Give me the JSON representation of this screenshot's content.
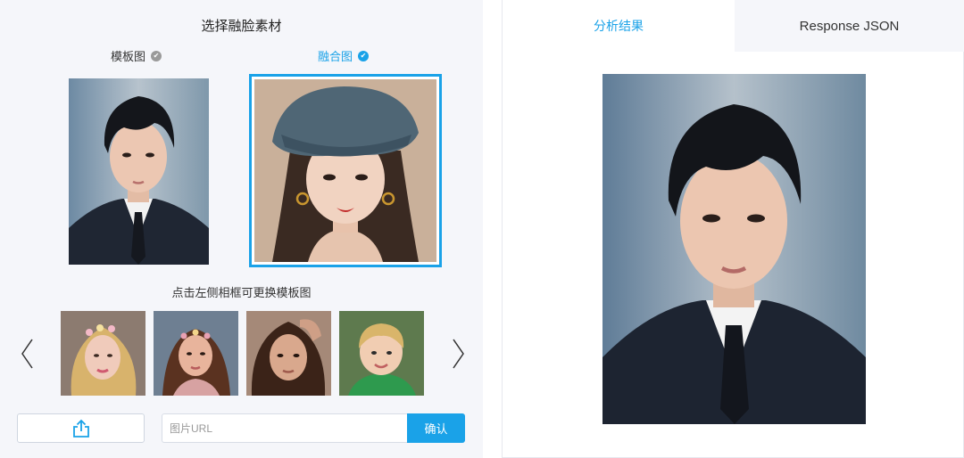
{
  "left": {
    "title": "选择融脸素材",
    "template_label": "模板图",
    "fusion_label": "融合图",
    "hint": "点击左侧相框可更换模板图",
    "url_placeholder": "图片URL",
    "confirm_label": "确认"
  },
  "tabs": [
    {
      "label": "分析结果",
      "active": true
    },
    {
      "label": "Response JSON",
      "active": false
    }
  ],
  "colors": {
    "accent": "#1aa2e8",
    "panel_bg": "#f5f6fa"
  },
  "icons": {
    "check": "check-circle-icon",
    "upload": "upload-icon",
    "prev": "chevron-left-icon",
    "next": "chevron-right-icon"
  }
}
